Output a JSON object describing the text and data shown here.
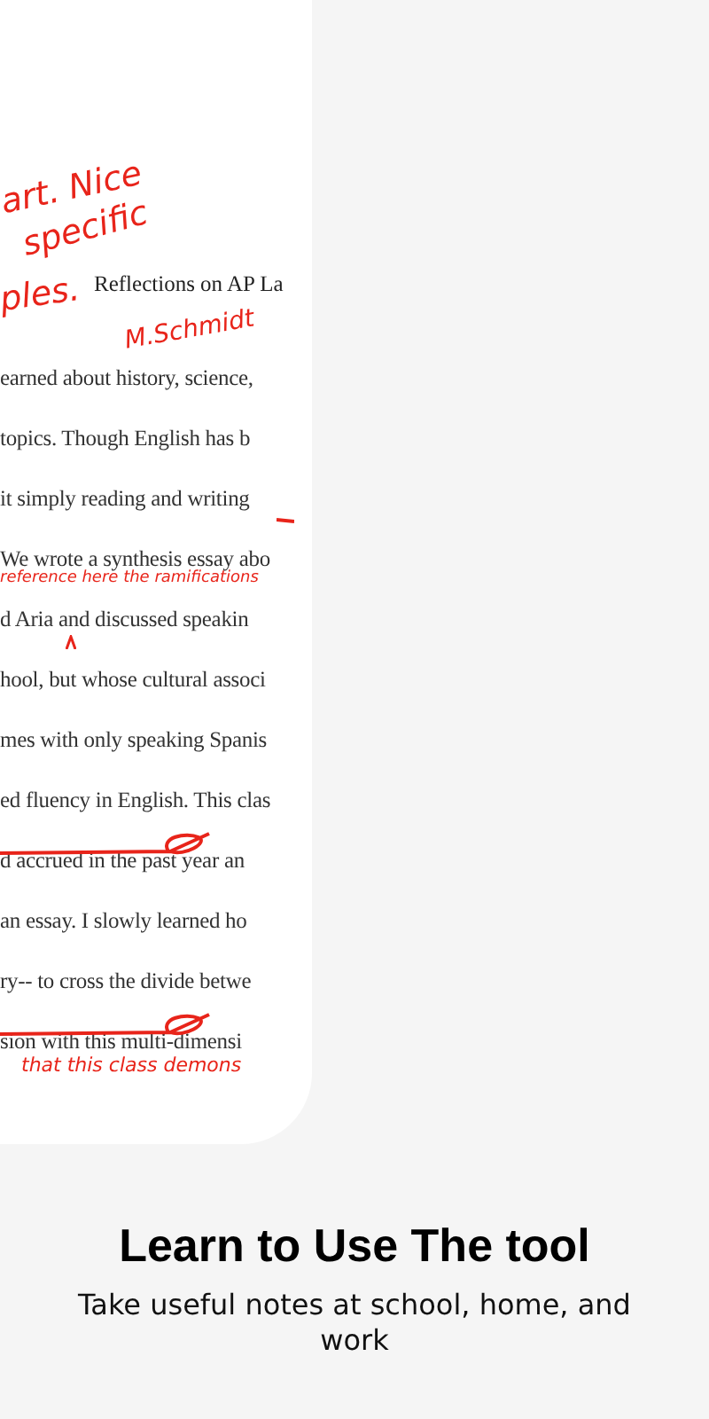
{
  "document": {
    "title": "Reflections on AP La",
    "lines": [
      {
        "text": "earned about history, science,",
        "struck": false
      },
      {
        "text": "topics. Though English has b",
        "struck": false
      },
      {
        "text": "it simply reading and writing",
        "struck": false
      },
      {
        "text": "We wrote a synthesis essay abo",
        "struck": false
      },
      {
        "text": "d Aria and discussed speakin",
        "struck": false
      },
      {
        "text": "hool, but whose cultural associ",
        "struck": false
      },
      {
        "text": "mes with only speaking Spanis",
        "struck": false
      },
      {
        "text": "ed fluency in English. This clas",
        "struck": false
      },
      {
        "text": "d accrued in the past year an",
        "struck": true
      },
      {
        "text": "an essay. I slowly learned ho",
        "struck": false
      },
      {
        "text": "ry-- to cross the divide betwe",
        "struck": false
      },
      {
        "text": "sion with this multi-dimensi",
        "struck": true
      }
    ]
  },
  "annotations": [
    {
      "text": "art. Nice"
    },
    {
      "text": "specific"
    },
    {
      "text": "ples."
    },
    {
      "text": "M.Schmidt"
    },
    {
      "text": "reference here  the ramifications"
    },
    {
      "text": "that this class demons"
    }
  ],
  "heading": "Learn to Use The tool",
  "subtitle": "Take useful notes at school, home, and work"
}
